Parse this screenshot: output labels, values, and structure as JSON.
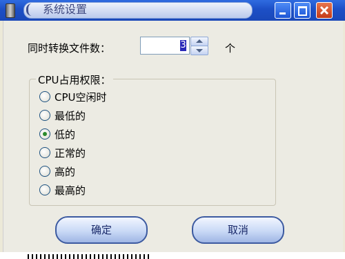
{
  "window": {
    "title": "系统设置",
    "icons": {
      "app": "app-icon",
      "minimize": "minimize-icon",
      "maximize": "maximize-icon",
      "close": "close-icon"
    },
    "colors": {
      "titlebar": "#1c4fc6",
      "close_button": "#c43a17",
      "background": "#ecebe3"
    }
  },
  "settings": {
    "file_count_label": "同时转换文件数：",
    "file_count_value": "3",
    "file_count_unit": "个",
    "spinner_icons": [
      "up-arrow-icon",
      "down-arrow-icon"
    ]
  },
  "cpu_priority": {
    "legend": "CPU占用权限：",
    "options": [
      {
        "label": "CPU空闲时",
        "checked": false
      },
      {
        "label": "最低的",
        "checked": false
      },
      {
        "label": "低的",
        "checked": true
      },
      {
        "label": "正常的",
        "checked": false
      },
      {
        "label": "高的",
        "checked": false
      },
      {
        "label": "最高的",
        "checked": false
      }
    ]
  },
  "buttons": {
    "ok": "确定",
    "cancel": "取消"
  }
}
